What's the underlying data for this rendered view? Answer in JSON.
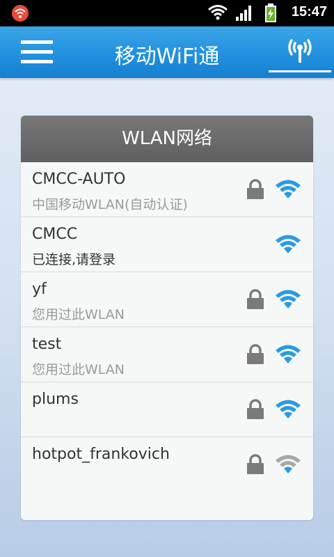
{
  "status_bar": {
    "time": "15:47",
    "icons": [
      "app-notification-icon",
      "wifi-signal-icon",
      "cell-signal-icon",
      "battery-charging-icon"
    ]
  },
  "app_bar": {
    "title": "移动WiFi通",
    "menu_icon": "hamburger-menu-icon",
    "tab_icon": "wlan-antenna-icon"
  },
  "panel": {
    "title": "WLAN网络",
    "networks": [
      {
        "name": "CMCC-AUTO",
        "status": "中国移动WLAN(自动认证)",
        "locked": true,
        "signal": "strong"
      },
      {
        "name": "CMCC",
        "status": "已连接,请登录",
        "locked": false,
        "signal": "strong"
      },
      {
        "name": "yf",
        "status": "您用过此WLAN",
        "locked": true,
        "signal": "strong"
      },
      {
        "name": "test",
        "status": "您用过此WLAN",
        "locked": true,
        "signal": "strong"
      },
      {
        "name": "plums",
        "status": "",
        "locked": true,
        "signal": "strong"
      },
      {
        "name": "hotpot_frankovich",
        "status": "",
        "locked": true,
        "signal": "weak"
      }
    ]
  },
  "colors": {
    "accent": "#1f8fdd",
    "wifi_active": "#2a9be3",
    "wifi_weak": "#a8a8a8",
    "header_gray": "#6a6a6a"
  }
}
